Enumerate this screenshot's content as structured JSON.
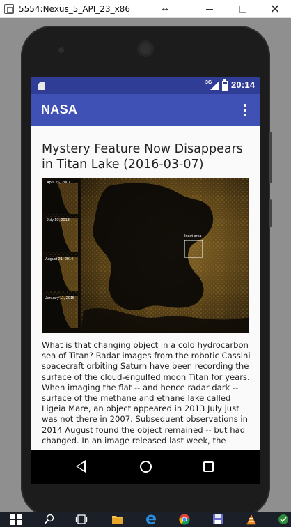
{
  "window": {
    "title": "5554:Nexus_5_API_23_x86",
    "resize_glyph": "↔",
    "close_glyph": "✕"
  },
  "statusbar": {
    "network": "3G",
    "time": "20:14"
  },
  "appbar": {
    "title": "NASA"
  },
  "article": {
    "title": "Mystery Feature Now Disappears in Titan Lake (2016-03-07)",
    "image_labels": {
      "date_1": "April 26, 2007",
      "date_2": "July 10, 2013",
      "date_3": "August 21, 2014",
      "date_4": "January 11, 2015",
      "inset": "Inset area"
    },
    "body": "What is that changing object in a cold hydrocarbon sea of Titan? Radar images from the robotic Cassini spacecraft orbiting Saturn have been recording the surface of the cloud-engulfed moon Titan for years. When imaging the flat -- and hence radar dark -- surface of the methane and ethane lake called Ligeia Mare, an object appeared in 2013 July just was not there in 2007. Subsequent observations in 2014 August found the object remained -- but had changed. In an image released last week, the"
  },
  "colors": {
    "statusbar": "#2f3d96",
    "appbar": "#3f51b5",
    "background": "#fafafa"
  },
  "icons": {
    "overflow": "more-vert-icon",
    "back": "back-triangle-icon",
    "home": "home-circle-icon",
    "recents": "recents-square-icon"
  }
}
